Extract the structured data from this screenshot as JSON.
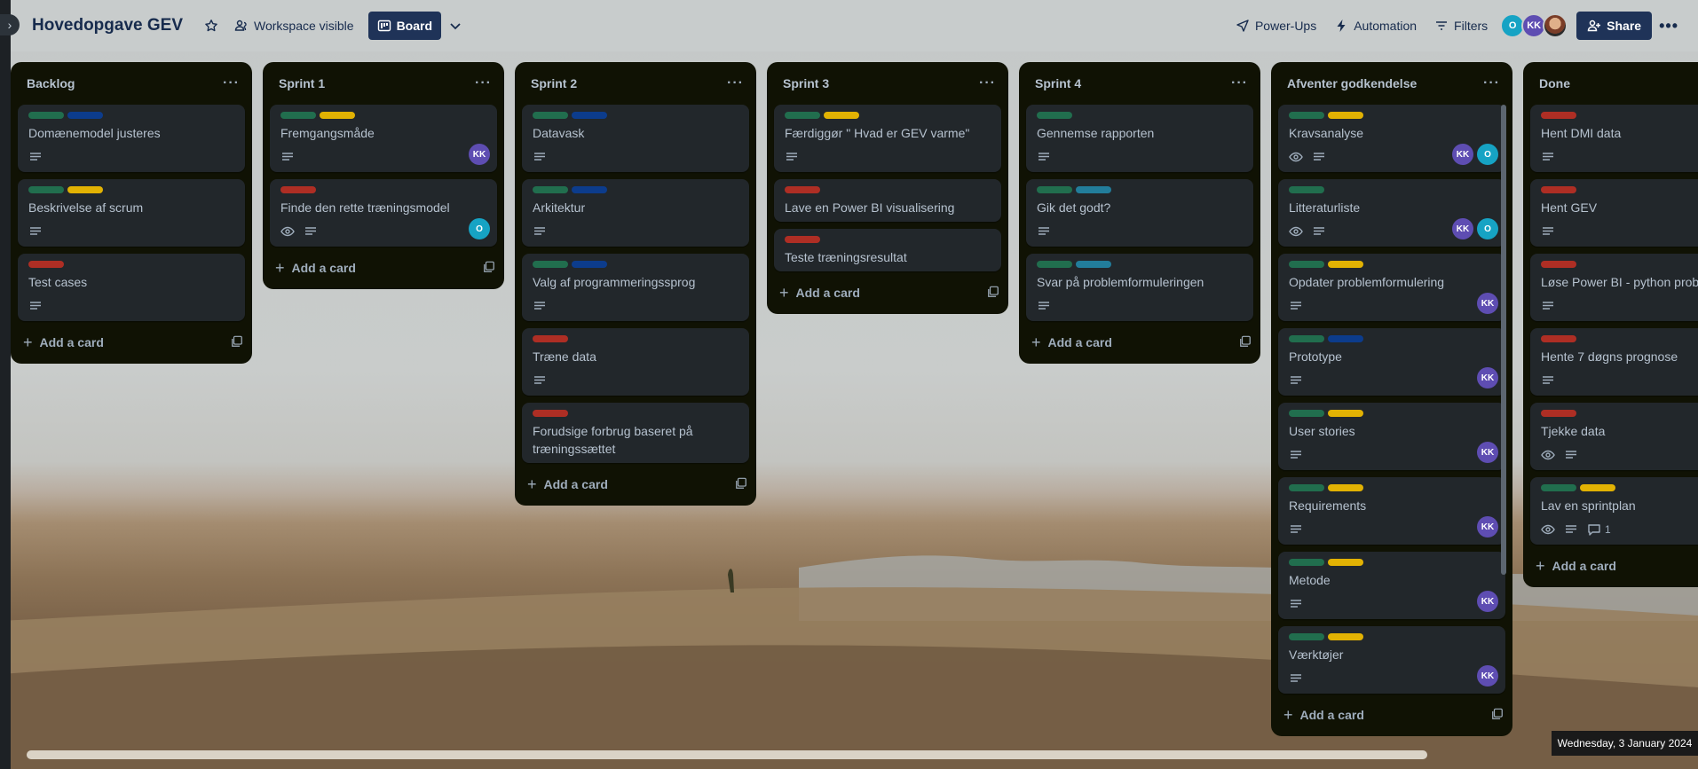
{
  "header": {
    "board_title": "Hovedopgave GEV",
    "visibility": "Workspace visible",
    "view": "Board",
    "powerups": "Power-Ups",
    "automation": "Automation",
    "filters": "Filters",
    "share": "Share",
    "members": [
      "O",
      "KK",
      ""
    ]
  },
  "colors": {
    "green": "#216e4e",
    "blue": "#0c3c8c",
    "yellow": "#e2b203",
    "red": "#ae2e24",
    "teal": "#227d9b",
    "list_bg": "#101204",
    "card_bg": "#22272b",
    "board_button": "#1f3358"
  },
  "add_card_label": "Add a card",
  "lists": [
    {
      "title": "Backlog",
      "cards": [
        {
          "title": "Domænemodel justeres",
          "labels": [
            "green",
            "blue"
          ],
          "watch": false,
          "desc": true,
          "members": []
        },
        {
          "title": "Beskrivelse af scrum",
          "labels": [
            "green",
            "yellow"
          ],
          "watch": false,
          "desc": true,
          "members": []
        },
        {
          "title": "Test cases",
          "labels": [
            "red"
          ],
          "watch": false,
          "desc": true,
          "members": []
        }
      ]
    },
    {
      "title": "Sprint 1",
      "cards": [
        {
          "title": "Fremgangsmåde",
          "labels": [
            "green",
            "yellow"
          ],
          "watch": false,
          "desc": true,
          "members": [
            "KK"
          ]
        },
        {
          "title": "Finde den rette træningsmodel",
          "labels": [
            "red"
          ],
          "watch": true,
          "desc": true,
          "members": [
            "O"
          ]
        }
      ]
    },
    {
      "title": "Sprint 2",
      "cards": [
        {
          "title": "Datavask",
          "labels": [
            "green",
            "blue"
          ],
          "watch": false,
          "desc": true,
          "members": []
        },
        {
          "title": "Arkitektur",
          "labels": [
            "green",
            "blue"
          ],
          "watch": false,
          "desc": true,
          "members": []
        },
        {
          "title": "Valg af programmeringssprog",
          "labels": [
            "green",
            "blue"
          ],
          "watch": false,
          "desc": true,
          "members": []
        },
        {
          "title": "Træne data",
          "labels": [
            "red"
          ],
          "watch": false,
          "desc": true,
          "members": []
        },
        {
          "title": "Forudsige forbrug baseret på træningssættet",
          "labels": [
            "red"
          ],
          "watch": false,
          "desc": false,
          "members": []
        }
      ]
    },
    {
      "title": "Sprint 3",
      "cards": [
        {
          "title": "Færdiggør \" Hvad er GEV varme\"",
          "labels": [
            "green",
            "yellow"
          ],
          "watch": false,
          "desc": true,
          "members": []
        },
        {
          "title": "Lave en Power BI visualisering",
          "labels": [
            "red"
          ],
          "watch": false,
          "desc": false,
          "members": []
        },
        {
          "title": "Teste træningsresultat",
          "labels": [
            "red"
          ],
          "watch": false,
          "desc": false,
          "members": []
        }
      ]
    },
    {
      "title": "Sprint 4",
      "cards": [
        {
          "title": "Gennemse rapporten",
          "labels": [
            "green"
          ],
          "watch": false,
          "desc": true,
          "members": []
        },
        {
          "title": "Gik det godt?",
          "labels": [
            "green",
            "teal"
          ],
          "watch": false,
          "desc": true,
          "members": []
        },
        {
          "title": "Svar på problemformuleringen",
          "labels": [
            "green",
            "teal"
          ],
          "watch": false,
          "desc": true,
          "members": []
        }
      ]
    },
    {
      "title": "Afventer godkendelse",
      "cards": [
        {
          "title": "Kravsanalyse",
          "labels": [
            "green",
            "yellow"
          ],
          "watch": true,
          "desc": true,
          "members": [
            "KK",
            "O"
          ]
        },
        {
          "title": "Litteraturliste",
          "labels": [
            "green"
          ],
          "watch": true,
          "desc": true,
          "members": [
            "KK",
            "O"
          ]
        },
        {
          "title": "Opdater problemformulering",
          "labels": [
            "green",
            "yellow"
          ],
          "watch": false,
          "desc": true,
          "members": [
            "KK"
          ]
        },
        {
          "title": "Prototype",
          "labels": [
            "green",
            "blue"
          ],
          "watch": false,
          "desc": true,
          "members": [
            "KK"
          ]
        },
        {
          "title": "User stories",
          "labels": [
            "green",
            "yellow"
          ],
          "watch": false,
          "desc": true,
          "members": [
            "KK"
          ]
        },
        {
          "title": "Requirements",
          "labels": [
            "green",
            "yellow"
          ],
          "watch": false,
          "desc": true,
          "members": [
            "KK"
          ]
        },
        {
          "title": "Metode",
          "labels": [
            "green",
            "yellow"
          ],
          "watch": false,
          "desc": true,
          "members": [
            "KK"
          ]
        },
        {
          "title": "Værktøjer",
          "labels": [
            "green",
            "yellow"
          ],
          "watch": false,
          "desc": true,
          "members": [
            "KK"
          ]
        }
      ]
    },
    {
      "title": "Done",
      "cards": [
        {
          "title": "Hent DMI data",
          "labels": [
            "red"
          ],
          "watch": false,
          "desc": true,
          "members": []
        },
        {
          "title": "Hent GEV",
          "labels": [
            "red"
          ],
          "watch": false,
          "desc": true,
          "members": []
        },
        {
          "title": "Løse Power BI - python problem",
          "labels": [
            "red"
          ],
          "watch": false,
          "desc": true,
          "members": []
        },
        {
          "title": "Hente 7 døgns prognose",
          "labels": [
            "red"
          ],
          "watch": false,
          "desc": true,
          "members": []
        },
        {
          "title": "Tjekke data",
          "labels": [
            "red"
          ],
          "watch": true,
          "desc": true,
          "members": []
        },
        {
          "title": "Lav en sprintplan",
          "labels": [
            "green",
            "yellow"
          ],
          "watch": true,
          "desc": true,
          "comments": "1",
          "members": []
        }
      ]
    }
  ],
  "taskbar_date": "Wednesday, 3 January 2024"
}
